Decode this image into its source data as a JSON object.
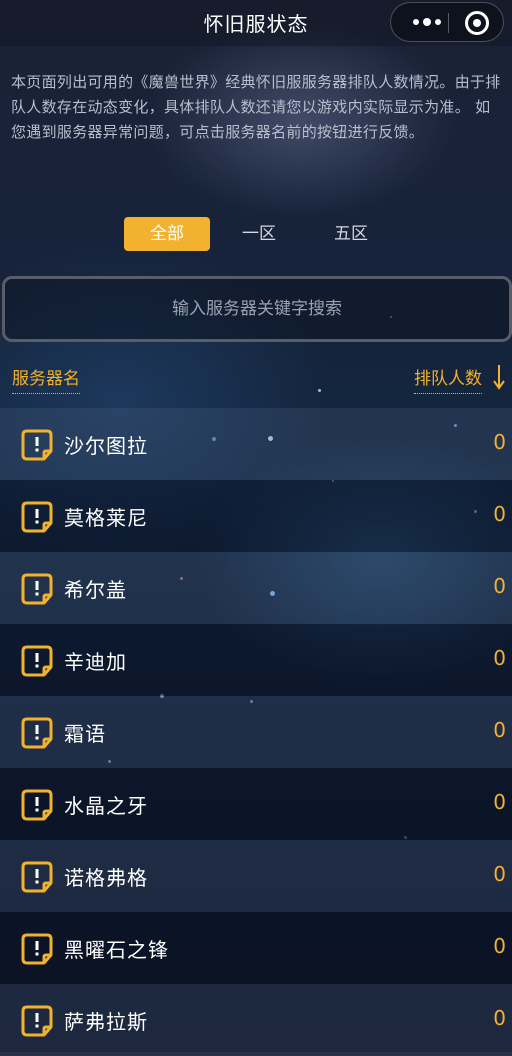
{
  "header": {
    "title": "怀旧服状态"
  },
  "notice": "本页面列出可用的《魔兽世界》经典怀旧服服务器排队人数情况。由于排队人数存在动态变化，具体排队人数还请您以游戏内实际显示为准。 如您遇到服务器异常问题，可点击服务器名前的按钮进行反馈。",
  "tabs": [
    {
      "label": "全部",
      "active": true
    },
    {
      "label": "一区",
      "active": false
    },
    {
      "label": "五区",
      "active": false
    }
  ],
  "search": {
    "placeholder": "输入服务器关键字搜索",
    "value": ""
  },
  "columns": {
    "server_name": "服务器名",
    "queue_count": "排队人数"
  },
  "servers": [
    {
      "name": "沙尔图拉",
      "queue": "0"
    },
    {
      "name": "莫格莱尼",
      "queue": "0"
    },
    {
      "name": "希尔盖",
      "queue": "0"
    },
    {
      "name": "辛迪加",
      "queue": "0"
    },
    {
      "name": "霜语",
      "queue": "0"
    },
    {
      "name": "水晶之牙",
      "queue": "0"
    },
    {
      "name": "诺格弗格",
      "queue": "0"
    },
    {
      "name": "黑曜石之锋",
      "queue": "0"
    },
    {
      "name": "萨弗拉斯",
      "queue": "0"
    }
  ],
  "colors": {
    "accent": "#f2b12e",
    "text": "#ffffff",
    "muted": "#b7bfcc"
  },
  "icons": {
    "feedback": "feedback-icon",
    "sort": "sort-down-arrow-icon",
    "more": "more-dots-icon",
    "close": "target-icon"
  }
}
